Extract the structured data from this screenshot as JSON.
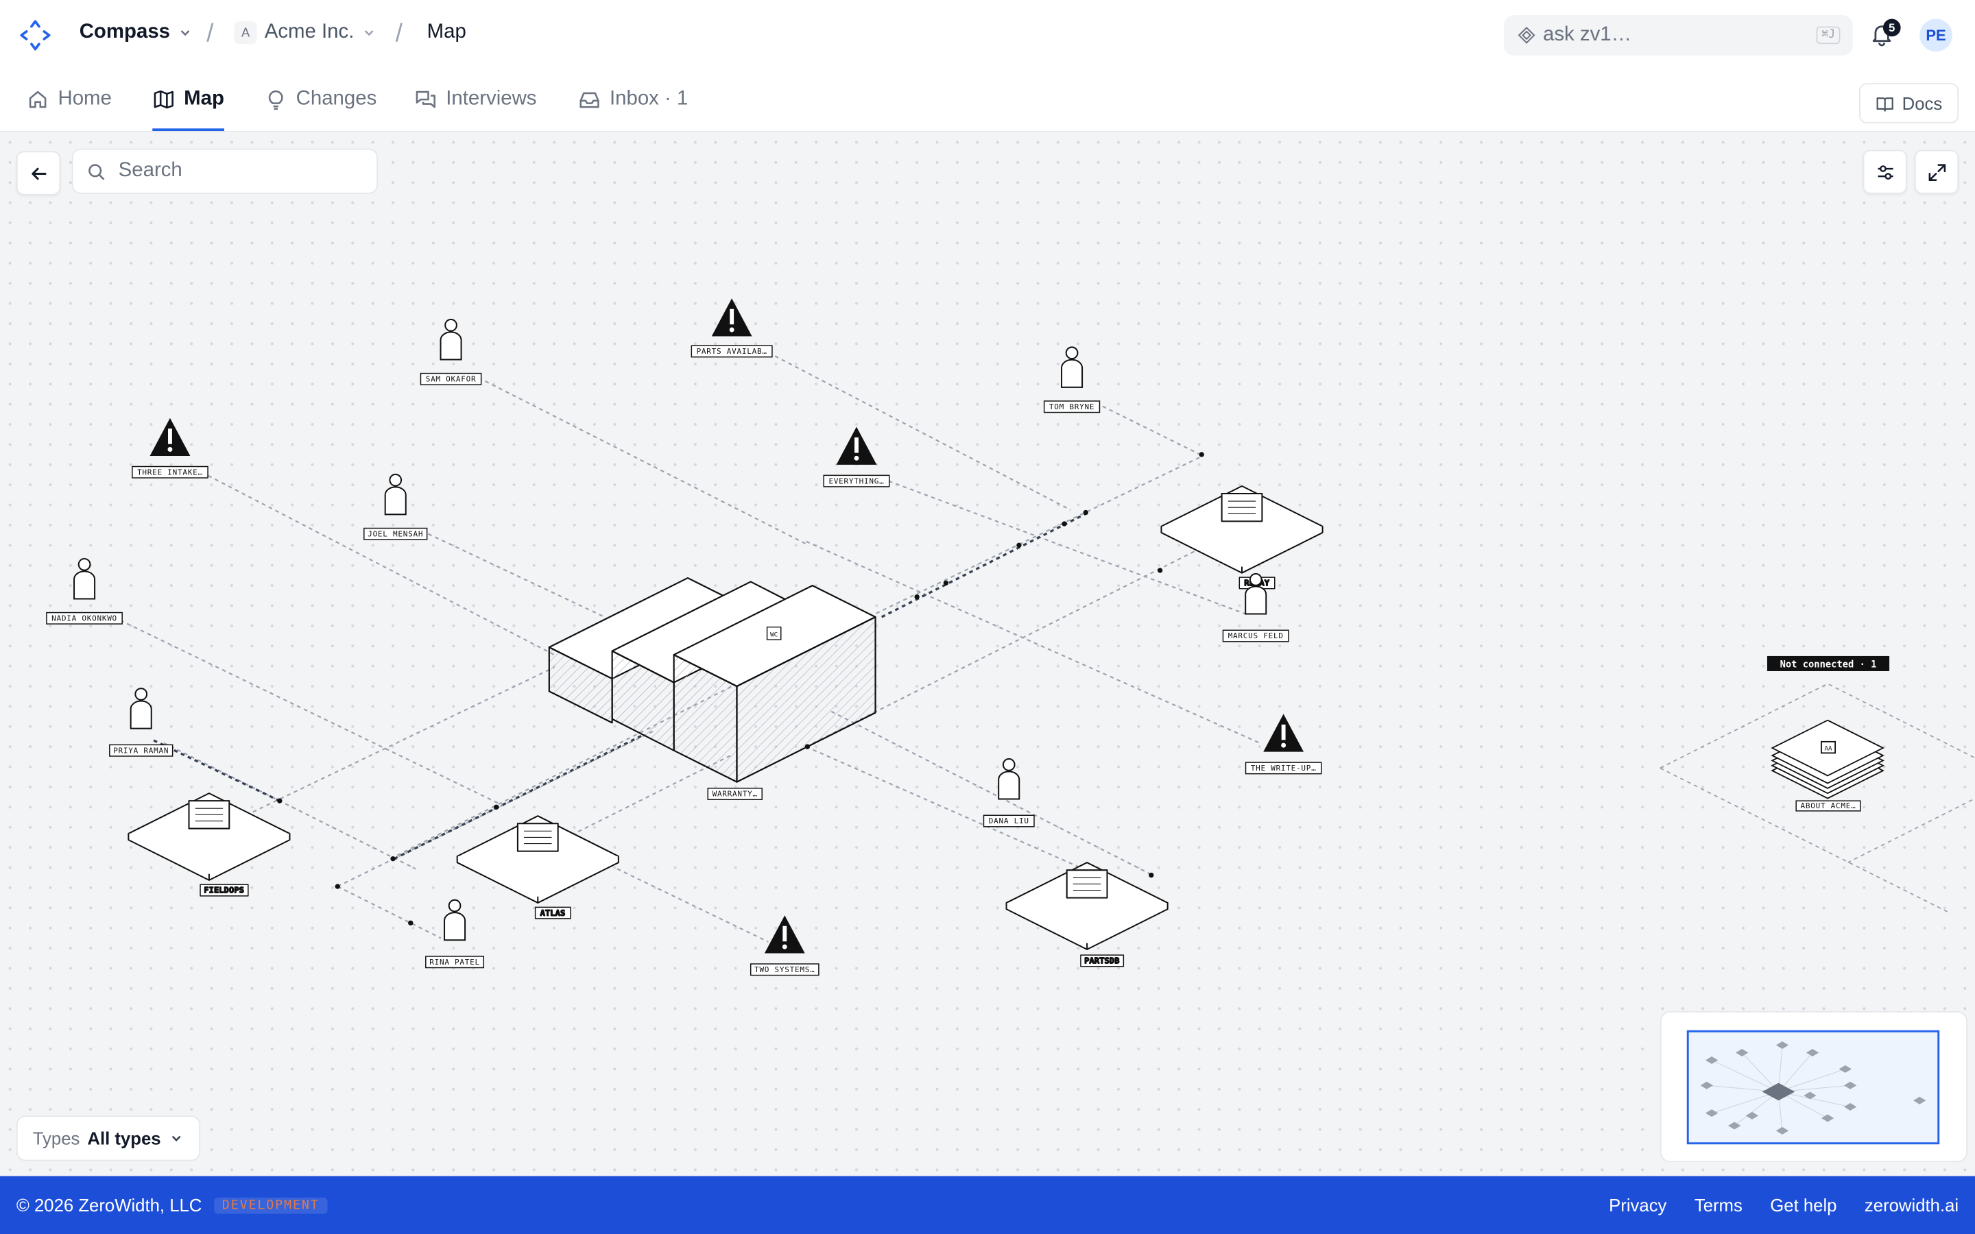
{
  "header": {
    "app_name": "Compass",
    "org_initial": "A",
    "org_name": "Acme Inc.",
    "page": "Map",
    "ask_placeholder": "ask zv1…",
    "ask_shortcut": "⌘J",
    "notification_count": "5",
    "avatar_initials": "PE"
  },
  "tabs": [
    {
      "label": "Home",
      "icon": "home-icon"
    },
    {
      "label": "Map",
      "icon": "map-icon",
      "active": true
    },
    {
      "label": "Changes",
      "icon": "lightbulb-icon"
    },
    {
      "label": "Interviews",
      "icon": "chat-icon"
    },
    {
      "label": "Inbox · 1",
      "icon": "inbox-icon"
    }
  ],
  "docs_label": "Docs",
  "search": {
    "placeholder": "Search"
  },
  "types_filter": {
    "label": "Types",
    "value": "All types"
  },
  "map": {
    "people": [
      "SAM OKAFOR",
      "TOM BRYNE",
      "JOEL MENSAH",
      "NADIA OKONKWO",
      "PRIYA RAMAN",
      "MARCUS FELD",
      "DANA LIU",
      "RINA PATEL"
    ],
    "issues": [
      "PARTS AVAILAB…",
      "THREE INTAKE…",
      "EVERYTHING…",
      "THE WRITE-UP…",
      "TWO SYSTEMS…"
    ],
    "systems": [
      "RELAY",
      "FIELDOPS",
      "ATLAS",
      "PARTSDB"
    ],
    "hub": {
      "label": "WARRANTY…",
      "badge": "WC"
    },
    "disconnected": {
      "title": "Not connected · 1",
      "badge": "AA",
      "label": "ABOUT ACME…"
    }
  },
  "footer": {
    "copyright": "© 2026 ZeroWidth, LLC",
    "env_badge": "DEVELOPMENT",
    "links": [
      "Privacy",
      "Terms",
      "Get help",
      "zerowidth.ai"
    ]
  },
  "colors": {
    "accent": "#2563eb",
    "footer_bg": "#1d4ed8",
    "canvas_bg": "#f3f4f6"
  }
}
